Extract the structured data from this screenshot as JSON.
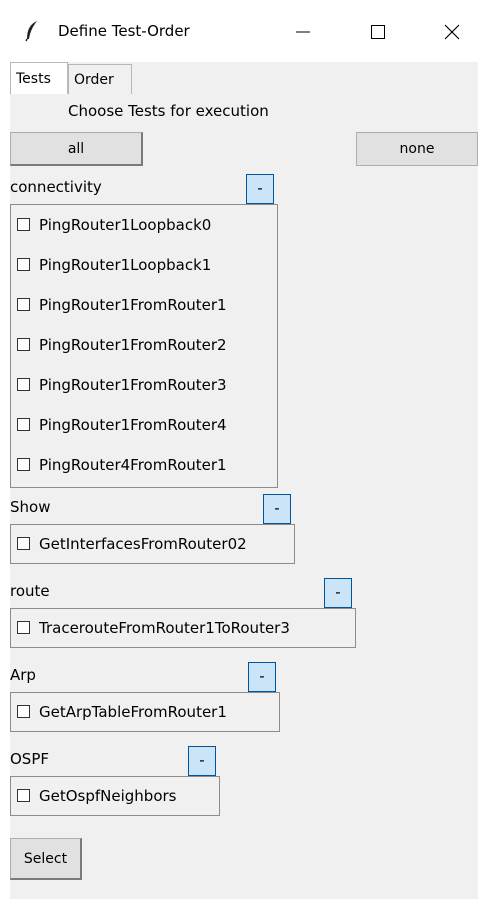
{
  "window": {
    "title": "Define Test-Order"
  },
  "tabs": [
    {
      "label": "Tests"
    },
    {
      "label": "Order"
    }
  ],
  "heading": "Choose Tests for execution",
  "buttons": {
    "all": "all",
    "none": "none",
    "select": "Select"
  },
  "groups": [
    {
      "name": "connectivity",
      "collapse": "-",
      "tests": [
        {
          "label": "PingRouter1Loopback0",
          "checked": false
        },
        {
          "label": "PingRouter1Loopback1",
          "checked": false
        },
        {
          "label": "PingRouter1FromRouter1",
          "checked": false
        },
        {
          "label": "PingRouter1FromRouter2",
          "checked": false
        },
        {
          "label": "PingRouter1FromRouter3",
          "checked": false
        },
        {
          "label": "PingRouter1FromRouter4",
          "checked": false
        },
        {
          "label": "PingRouter4FromRouter1",
          "checked": false
        }
      ]
    },
    {
      "name": "Show",
      "collapse": "-",
      "tests": [
        {
          "label": "GetInterfacesFromRouter02",
          "checked": false
        }
      ]
    },
    {
      "name": "route",
      "collapse": "-",
      "tests": [
        {
          "label": "TracerouteFromRouter1ToRouter3",
          "checked": false
        }
      ]
    },
    {
      "name": "Arp",
      "collapse": "-",
      "tests": [
        {
          "label": "GetArpTableFromRouter1",
          "checked": false
        }
      ]
    },
    {
      "name": "OSPF",
      "collapse": "-",
      "tests": [
        {
          "label": "GetOspfNeighbors",
          "checked": false
        }
      ]
    }
  ]
}
